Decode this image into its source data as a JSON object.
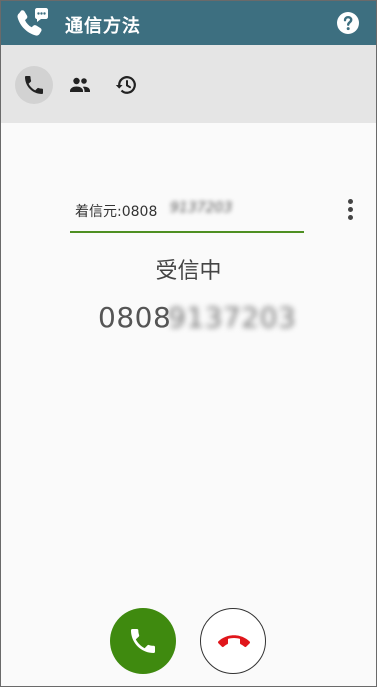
{
  "app": {
    "title": "通信方法"
  },
  "toolbar": {
    "items": [
      {
        "icon": "phone-icon",
        "active": true
      },
      {
        "icon": "contacts-icon",
        "active": false
      },
      {
        "icon": "history-icon",
        "active": false
      }
    ]
  },
  "call": {
    "caller_label": "着信元:0808",
    "caller_obscured": "9137203",
    "status": "受信中",
    "number_visible": "0808",
    "number_obscured": "9137203"
  },
  "colors": {
    "titlebar": "#3d6f80",
    "toolbar": "#e5e5e5",
    "accent_green": "#3f8a0f",
    "hangup_red": "#e0161b"
  }
}
